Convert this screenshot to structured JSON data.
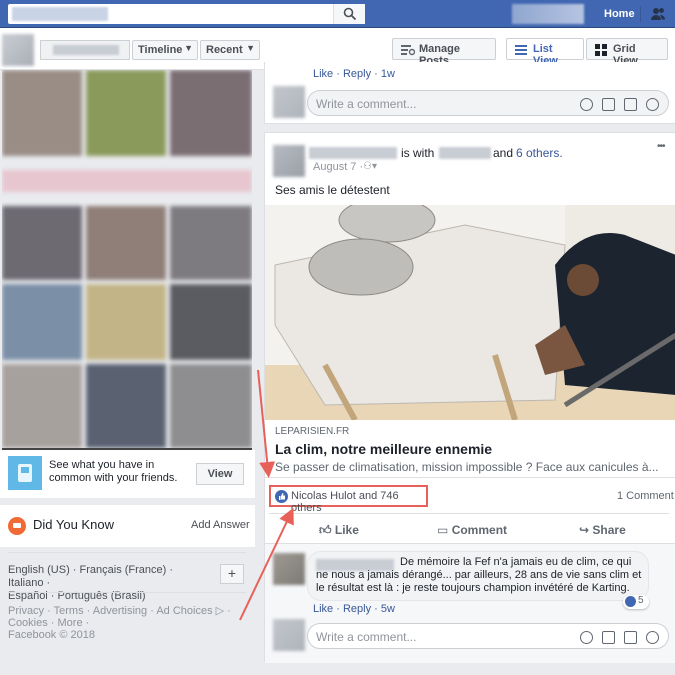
{
  "topbar": {
    "home_label": "Home"
  },
  "subbar": {
    "tabs": [
      "Timeline",
      "Recent"
    ],
    "manage_posts": "Manage Posts",
    "list_view": "List View",
    "grid_view": "Grid View"
  },
  "promo": {
    "text": "See what you have in common with your friends.",
    "button": "View"
  },
  "did_you_know": {
    "title": "Did You Know",
    "action": "Add Answer"
  },
  "languages": {
    "line1": "English (US) · Français (France) · Italiano ·",
    "line2": "Español · Português (Brasil)",
    "add": "+"
  },
  "footer": {
    "line1": "Privacy · Terms · Advertising · Ad Choices ▷ ·",
    "line2": "Cookies · More ·",
    "line3": "Facebook © 2018"
  },
  "prev_post": {
    "actions": "Like · Reply · 1w",
    "comment_placeholder": "Write a comment..."
  },
  "post": {
    "with_text": "is with",
    "and_text": "and",
    "others_text": "6 others.",
    "date": "August 7 ·",
    "body": "Ses amis le détestent",
    "more": "•••",
    "link": {
      "domain": "LEPARISIEN.FR",
      "title": "La clim, notre meilleure ennemie",
      "desc": "Se passer de climatisation, mission impossible ? Face aux canicules à..."
    },
    "reactions": "Nicolas Hulot and 746 others",
    "comments_count": "1 Comment",
    "actions": {
      "like": "Like",
      "comment": "Comment",
      "share": "Share"
    },
    "comment": {
      "text": "De mémoire la Fef n'a jamais eu de clim, ce qui ne nous a jamais dérangé... par ailleurs, 28 ans de vie sans clim et le résultat est là : je reste toujours champion invétéré de Karting.",
      "actions": "Like · Reply · 5w",
      "likes": "5"
    },
    "comment_placeholder": "Write a comment..."
  },
  "colors": {
    "brand": "#4267b2",
    "annotation": "#e8605a"
  }
}
